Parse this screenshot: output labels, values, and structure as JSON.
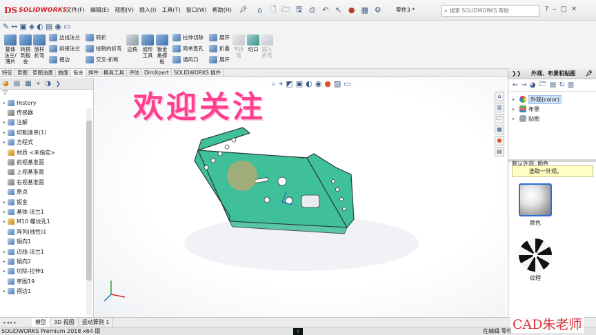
{
  "app": {
    "brand": "SOLIDWORKS",
    "document_name": "零件3 *",
    "search_placeholder": "搜索 SOLIDWORKS 帮助",
    "status_text": "SOLIDWORKS Premium 2018 x64 版",
    "status_right": "在编辑 零件"
  },
  "menu": [
    "文件(F)",
    "编辑(E)",
    "视图(V)",
    "插入(I)",
    "工具(T)",
    "窗口(W)",
    "帮助(H)"
  ],
  "ribbon": {
    "large_tools": [
      {
        "label": "基体\n法兰/\n薄片",
        "disabled": false
      },
      {
        "label": "转换\n到钣\n金",
        "disabled": false
      },
      {
        "label": "放样\n折弯",
        "disabled": false
      },
      {
        "label": "边角",
        "disabled": false
      },
      {
        "label": "成形\n工具",
        "disabled": false
      },
      {
        "label": "钣金\n角撑\n板",
        "disabled": false
      },
      {
        "label": "不折\n弯",
        "disabled": true
      },
      {
        "label": "切口",
        "disabled": false
      },
      {
        "label": "插入\n折弯",
        "disabled": true
      }
    ],
    "small_tools": [
      {
        "label": "边线法兰",
        "disabled": false
      },
      {
        "label": "斜接法兰",
        "disabled": false
      },
      {
        "label": "褶边",
        "disabled": false
      },
      {
        "label": "转折",
        "disabled": false
      },
      {
        "label": "绘制的折弯",
        "disabled": false
      },
      {
        "label": "交叉-折断",
        "disabled": false
      },
      {
        "label": "拉伸切除",
        "disabled": false
      },
      {
        "label": "简单直孔",
        "disabled": false
      },
      {
        "label": "通风口",
        "disabled": false
      },
      {
        "label": "展开",
        "disabled": false
      },
      {
        "label": "折叠",
        "disabled": false
      },
      {
        "label": "展开",
        "disabled": false
      }
    ]
  },
  "tabs": [
    "特征",
    "草图",
    "草图油墨",
    "曲面",
    "钣金",
    "焊件",
    "模具工具",
    "评估",
    "DimXpert",
    "SOLIDWORKS 插件"
  ],
  "active_tab": 4,
  "feature_tree": [
    {
      "label": "History",
      "expand": true,
      "icon": "history-icon"
    },
    {
      "label": "传感器",
      "expand": false,
      "icon": "sensor-icon"
    },
    {
      "label": "注解",
      "expand": true,
      "icon": "annotation-icon"
    },
    {
      "label": "切割清单(1)",
      "expand": true,
      "icon": "cutlist-icon"
    },
    {
      "label": "方程式",
      "expand": true,
      "icon": "equation-icon"
    },
    {
      "label": "材质 <未指定>",
      "expand": false,
      "icon": "material-icon"
    },
    {
      "label": "前视基准面",
      "expand": false,
      "icon": "plane-icon"
    },
    {
      "label": "上视基准面",
      "expand": false,
      "icon": "plane-icon"
    },
    {
      "label": "右视基准面",
      "expand": false,
      "icon": "plane-icon"
    },
    {
      "label": "原点",
      "expand": false,
      "icon": "origin-icon"
    },
    {
      "label": "钣金",
      "expand": true,
      "icon": "sheetmetal-icon"
    },
    {
      "label": "基体-法兰1",
      "expand": true,
      "icon": "base-flange-icon"
    },
    {
      "label": "M10 螺纹孔1",
      "expand": true,
      "icon": "hole-icon"
    },
    {
      "label": "阵列(线性)1",
      "expand": false,
      "icon": "pattern-icon"
    },
    {
      "label": "镜向1",
      "expand": false,
      "icon": "mirror-icon"
    },
    {
      "label": "边线-法兰1",
      "expand": true,
      "icon": "edge-flange-icon"
    },
    {
      "label": "镜向2",
      "expand": true,
      "icon": "mirror-icon"
    },
    {
      "label": "切除-拉伸1",
      "expand": true,
      "icon": "cut-extrude-icon"
    },
    {
      "label": "草图19",
      "expand": false,
      "icon": "sketch-icon"
    },
    {
      "label": "褶边1",
      "expand": true,
      "icon": "hem-icon"
    }
  ],
  "viewport": {
    "overlay_text": "欢迎关注",
    "part_color": "#3fbf9a",
    "part_edge_color": "#2a3b38"
  },
  "task_pane": {
    "title": "外观、布景和贴图",
    "tree": [
      {
        "label": "外观(color)",
        "selected": true
      },
      {
        "label": "布景",
        "selected": false
      },
      {
        "label": "贴图",
        "selected": false
      }
    ],
    "default_label": "默认外观: 颜色",
    "hint": "选取一外观。",
    "swatches": [
      {
        "label": "颜色"
      },
      {
        "label": "纹理"
      }
    ]
  },
  "bottom_tabs": [
    "模型",
    "3D 视图",
    "运动算例 1"
  ],
  "active_bottom_tab": 0,
  "signature": "CAD朱老师"
}
